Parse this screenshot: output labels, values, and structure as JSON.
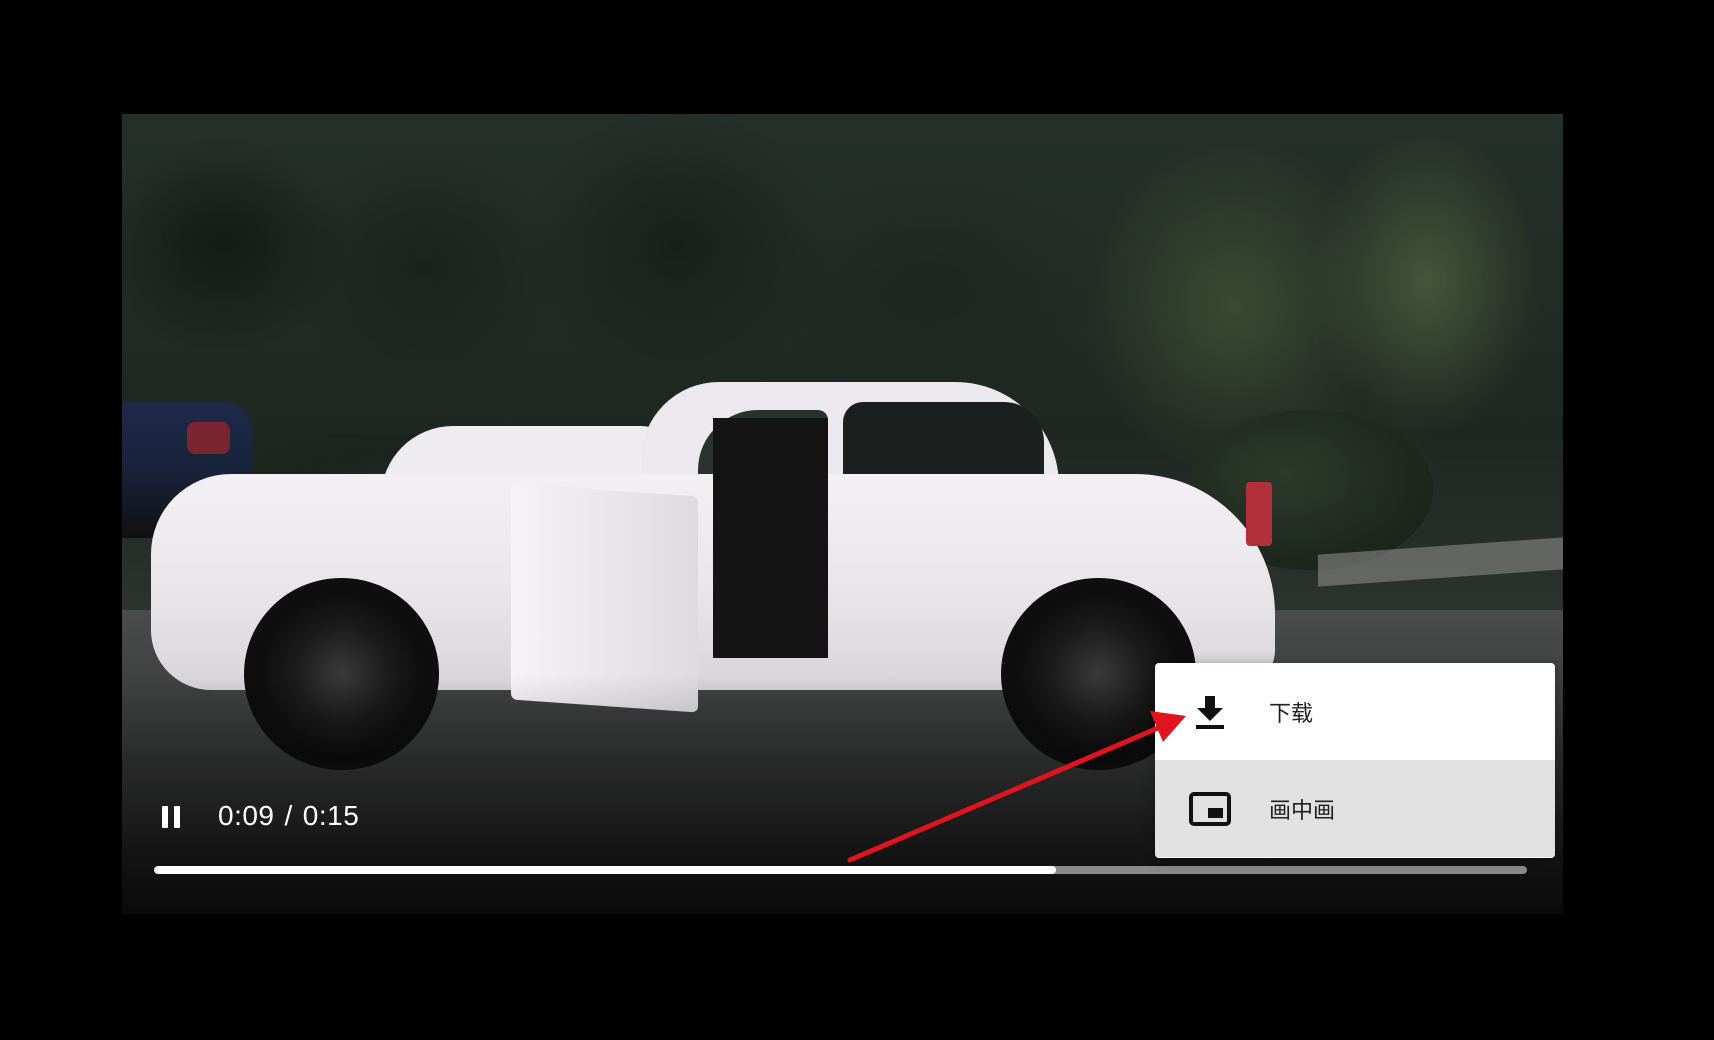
{
  "player": {
    "state": "playing",
    "current_time": "0:09",
    "separator": "/",
    "duration": "0:15",
    "progress_fraction": 0.657,
    "pause_icon": "pause-icon"
  },
  "menu": {
    "items": [
      {
        "label": "下载",
        "icon": "download-icon"
      },
      {
        "label": "画中画",
        "icon": "picture-in-picture-icon"
      }
    ],
    "hovered_index": 1
  },
  "annotation": {
    "type": "arrow",
    "color": "#e0141e",
    "points_to": "download-menu-item"
  },
  "colors": {
    "page_background": "#000000",
    "menu_background": "#ffffff",
    "menu_hover": "#e1e1e1",
    "progress_played": "#ffffff",
    "progress_track": "#8a8a8a"
  }
}
